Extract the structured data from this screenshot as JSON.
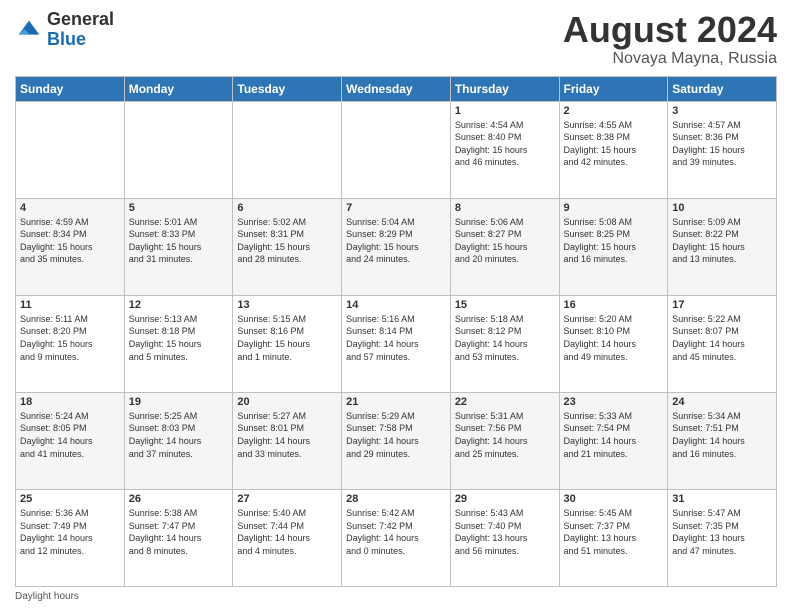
{
  "header": {
    "logo_general": "General",
    "logo_blue": "Blue",
    "main_title": "August 2024",
    "sub_title": "Novaya Mayna, Russia"
  },
  "calendar": {
    "headers": [
      "Sunday",
      "Monday",
      "Tuesday",
      "Wednesday",
      "Thursday",
      "Friday",
      "Saturday"
    ],
    "weeks": [
      [
        {
          "day": "",
          "info": ""
        },
        {
          "day": "",
          "info": ""
        },
        {
          "day": "",
          "info": ""
        },
        {
          "day": "",
          "info": ""
        },
        {
          "day": "1",
          "info": "Sunrise: 4:54 AM\nSunset: 8:40 PM\nDaylight: 15 hours\nand 46 minutes."
        },
        {
          "day": "2",
          "info": "Sunrise: 4:55 AM\nSunset: 8:38 PM\nDaylight: 15 hours\nand 42 minutes."
        },
        {
          "day": "3",
          "info": "Sunrise: 4:57 AM\nSunset: 8:36 PM\nDaylight: 15 hours\nand 39 minutes."
        }
      ],
      [
        {
          "day": "4",
          "info": "Sunrise: 4:59 AM\nSunset: 8:34 PM\nDaylight: 15 hours\nand 35 minutes."
        },
        {
          "day": "5",
          "info": "Sunrise: 5:01 AM\nSunset: 8:33 PM\nDaylight: 15 hours\nand 31 minutes."
        },
        {
          "day": "6",
          "info": "Sunrise: 5:02 AM\nSunset: 8:31 PM\nDaylight: 15 hours\nand 28 minutes."
        },
        {
          "day": "7",
          "info": "Sunrise: 5:04 AM\nSunset: 8:29 PM\nDaylight: 15 hours\nand 24 minutes."
        },
        {
          "day": "8",
          "info": "Sunrise: 5:06 AM\nSunset: 8:27 PM\nDaylight: 15 hours\nand 20 minutes."
        },
        {
          "day": "9",
          "info": "Sunrise: 5:08 AM\nSunset: 8:25 PM\nDaylight: 15 hours\nand 16 minutes."
        },
        {
          "day": "10",
          "info": "Sunrise: 5:09 AM\nSunset: 8:22 PM\nDaylight: 15 hours\nand 13 minutes."
        }
      ],
      [
        {
          "day": "11",
          "info": "Sunrise: 5:11 AM\nSunset: 8:20 PM\nDaylight: 15 hours\nand 9 minutes."
        },
        {
          "day": "12",
          "info": "Sunrise: 5:13 AM\nSunset: 8:18 PM\nDaylight: 15 hours\nand 5 minutes."
        },
        {
          "day": "13",
          "info": "Sunrise: 5:15 AM\nSunset: 8:16 PM\nDaylight: 15 hours\nand 1 minute."
        },
        {
          "day": "14",
          "info": "Sunrise: 5:16 AM\nSunset: 8:14 PM\nDaylight: 14 hours\nand 57 minutes."
        },
        {
          "day": "15",
          "info": "Sunrise: 5:18 AM\nSunset: 8:12 PM\nDaylight: 14 hours\nand 53 minutes."
        },
        {
          "day": "16",
          "info": "Sunrise: 5:20 AM\nSunset: 8:10 PM\nDaylight: 14 hours\nand 49 minutes."
        },
        {
          "day": "17",
          "info": "Sunrise: 5:22 AM\nSunset: 8:07 PM\nDaylight: 14 hours\nand 45 minutes."
        }
      ],
      [
        {
          "day": "18",
          "info": "Sunrise: 5:24 AM\nSunset: 8:05 PM\nDaylight: 14 hours\nand 41 minutes."
        },
        {
          "day": "19",
          "info": "Sunrise: 5:25 AM\nSunset: 8:03 PM\nDaylight: 14 hours\nand 37 minutes."
        },
        {
          "day": "20",
          "info": "Sunrise: 5:27 AM\nSunset: 8:01 PM\nDaylight: 14 hours\nand 33 minutes."
        },
        {
          "day": "21",
          "info": "Sunrise: 5:29 AM\nSunset: 7:58 PM\nDaylight: 14 hours\nand 29 minutes."
        },
        {
          "day": "22",
          "info": "Sunrise: 5:31 AM\nSunset: 7:56 PM\nDaylight: 14 hours\nand 25 minutes."
        },
        {
          "day": "23",
          "info": "Sunrise: 5:33 AM\nSunset: 7:54 PM\nDaylight: 14 hours\nand 21 minutes."
        },
        {
          "day": "24",
          "info": "Sunrise: 5:34 AM\nSunset: 7:51 PM\nDaylight: 14 hours\nand 16 minutes."
        }
      ],
      [
        {
          "day": "25",
          "info": "Sunrise: 5:36 AM\nSunset: 7:49 PM\nDaylight: 14 hours\nand 12 minutes."
        },
        {
          "day": "26",
          "info": "Sunrise: 5:38 AM\nSunset: 7:47 PM\nDaylight: 14 hours\nand 8 minutes."
        },
        {
          "day": "27",
          "info": "Sunrise: 5:40 AM\nSunset: 7:44 PM\nDaylight: 14 hours\nand 4 minutes."
        },
        {
          "day": "28",
          "info": "Sunrise: 5:42 AM\nSunset: 7:42 PM\nDaylight: 14 hours\nand 0 minutes."
        },
        {
          "day": "29",
          "info": "Sunrise: 5:43 AM\nSunset: 7:40 PM\nDaylight: 13 hours\nand 56 minutes."
        },
        {
          "day": "30",
          "info": "Sunrise: 5:45 AM\nSunset: 7:37 PM\nDaylight: 13 hours\nand 51 minutes."
        },
        {
          "day": "31",
          "info": "Sunrise: 5:47 AM\nSunset: 7:35 PM\nDaylight: 13 hours\nand 47 minutes."
        }
      ]
    ]
  },
  "footer": {
    "daylight_label": "Daylight hours"
  }
}
